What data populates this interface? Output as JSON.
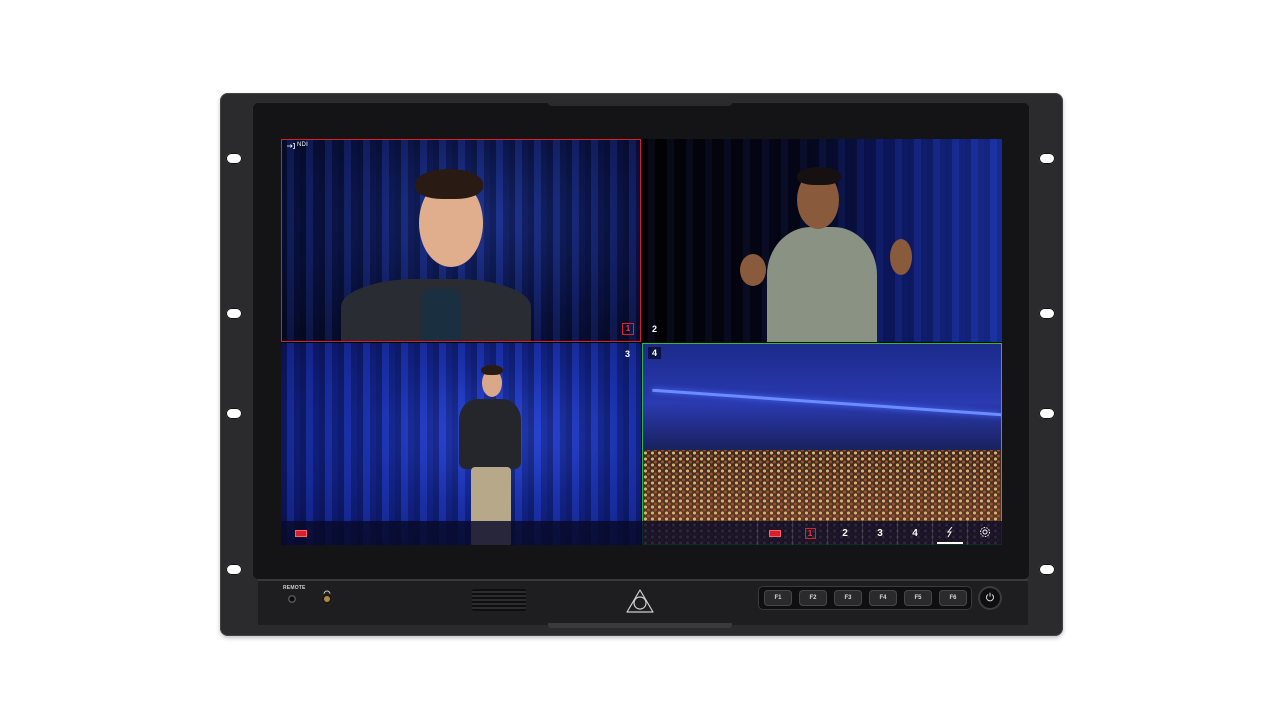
{
  "monitor": {
    "brand_logo": "atomos-logo-icon",
    "bezel_color": "#2b2b2d"
  },
  "screen": {
    "input_label": "NDI",
    "input_icon": "input-arrow-icon",
    "quadrants": [
      {
        "number": "1",
        "state": "program",
        "frame_color": "#d8202a"
      },
      {
        "number": "2",
        "state": "idle"
      },
      {
        "number": "3",
        "state": "idle"
      },
      {
        "number": "4",
        "state": "preview",
        "frame_color": "#22c03a"
      }
    ]
  },
  "control_bar": {
    "left_icon": "record-icon",
    "items": [
      {
        "icon": "record-icon"
      },
      {
        "label": "1",
        "style": "program-outline"
      },
      {
        "label": "2"
      },
      {
        "label": "3"
      },
      {
        "label": "4"
      },
      {
        "icon": "transition-icon",
        "active": true
      },
      {
        "icon": "gear-icon"
      }
    ]
  },
  "front_panel": {
    "remote_label": "REMOTE",
    "headphone_icon": "headphone-icon",
    "function_keys": [
      "F1",
      "F2",
      "F3",
      "F4",
      "F5",
      "F6"
    ],
    "power_icon": "power-icon"
  }
}
